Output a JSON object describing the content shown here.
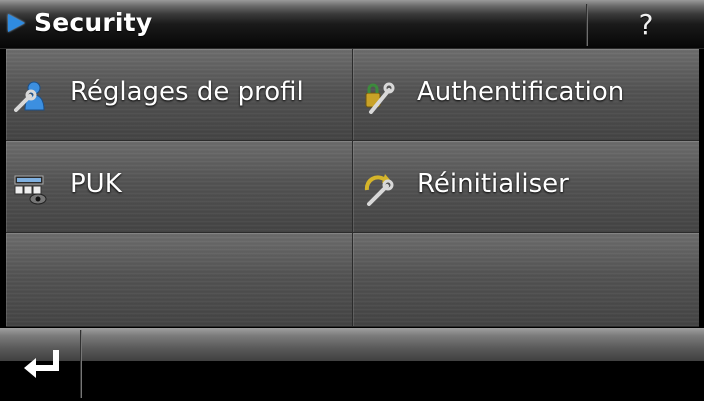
{
  "header": {
    "title": "Security",
    "help_label": "?"
  },
  "menu": {
    "items": [
      {
        "label": "Réglages de profil",
        "icon": "user-wrench-icon"
      },
      {
        "label": "Authentification",
        "icon": "lock-wrench-icon"
      },
      {
        "label": "PUK",
        "icon": "super-code-keypad-icon"
      },
      {
        "label": "Réinitialiser",
        "icon": "reset-wrench-icon"
      }
    ]
  },
  "footer": {
    "back_icon": "return-arrow-icon"
  },
  "colors": {
    "accent_blue": "#2f8be0",
    "panel_gray": "#545454",
    "bar_black": "#000000"
  }
}
